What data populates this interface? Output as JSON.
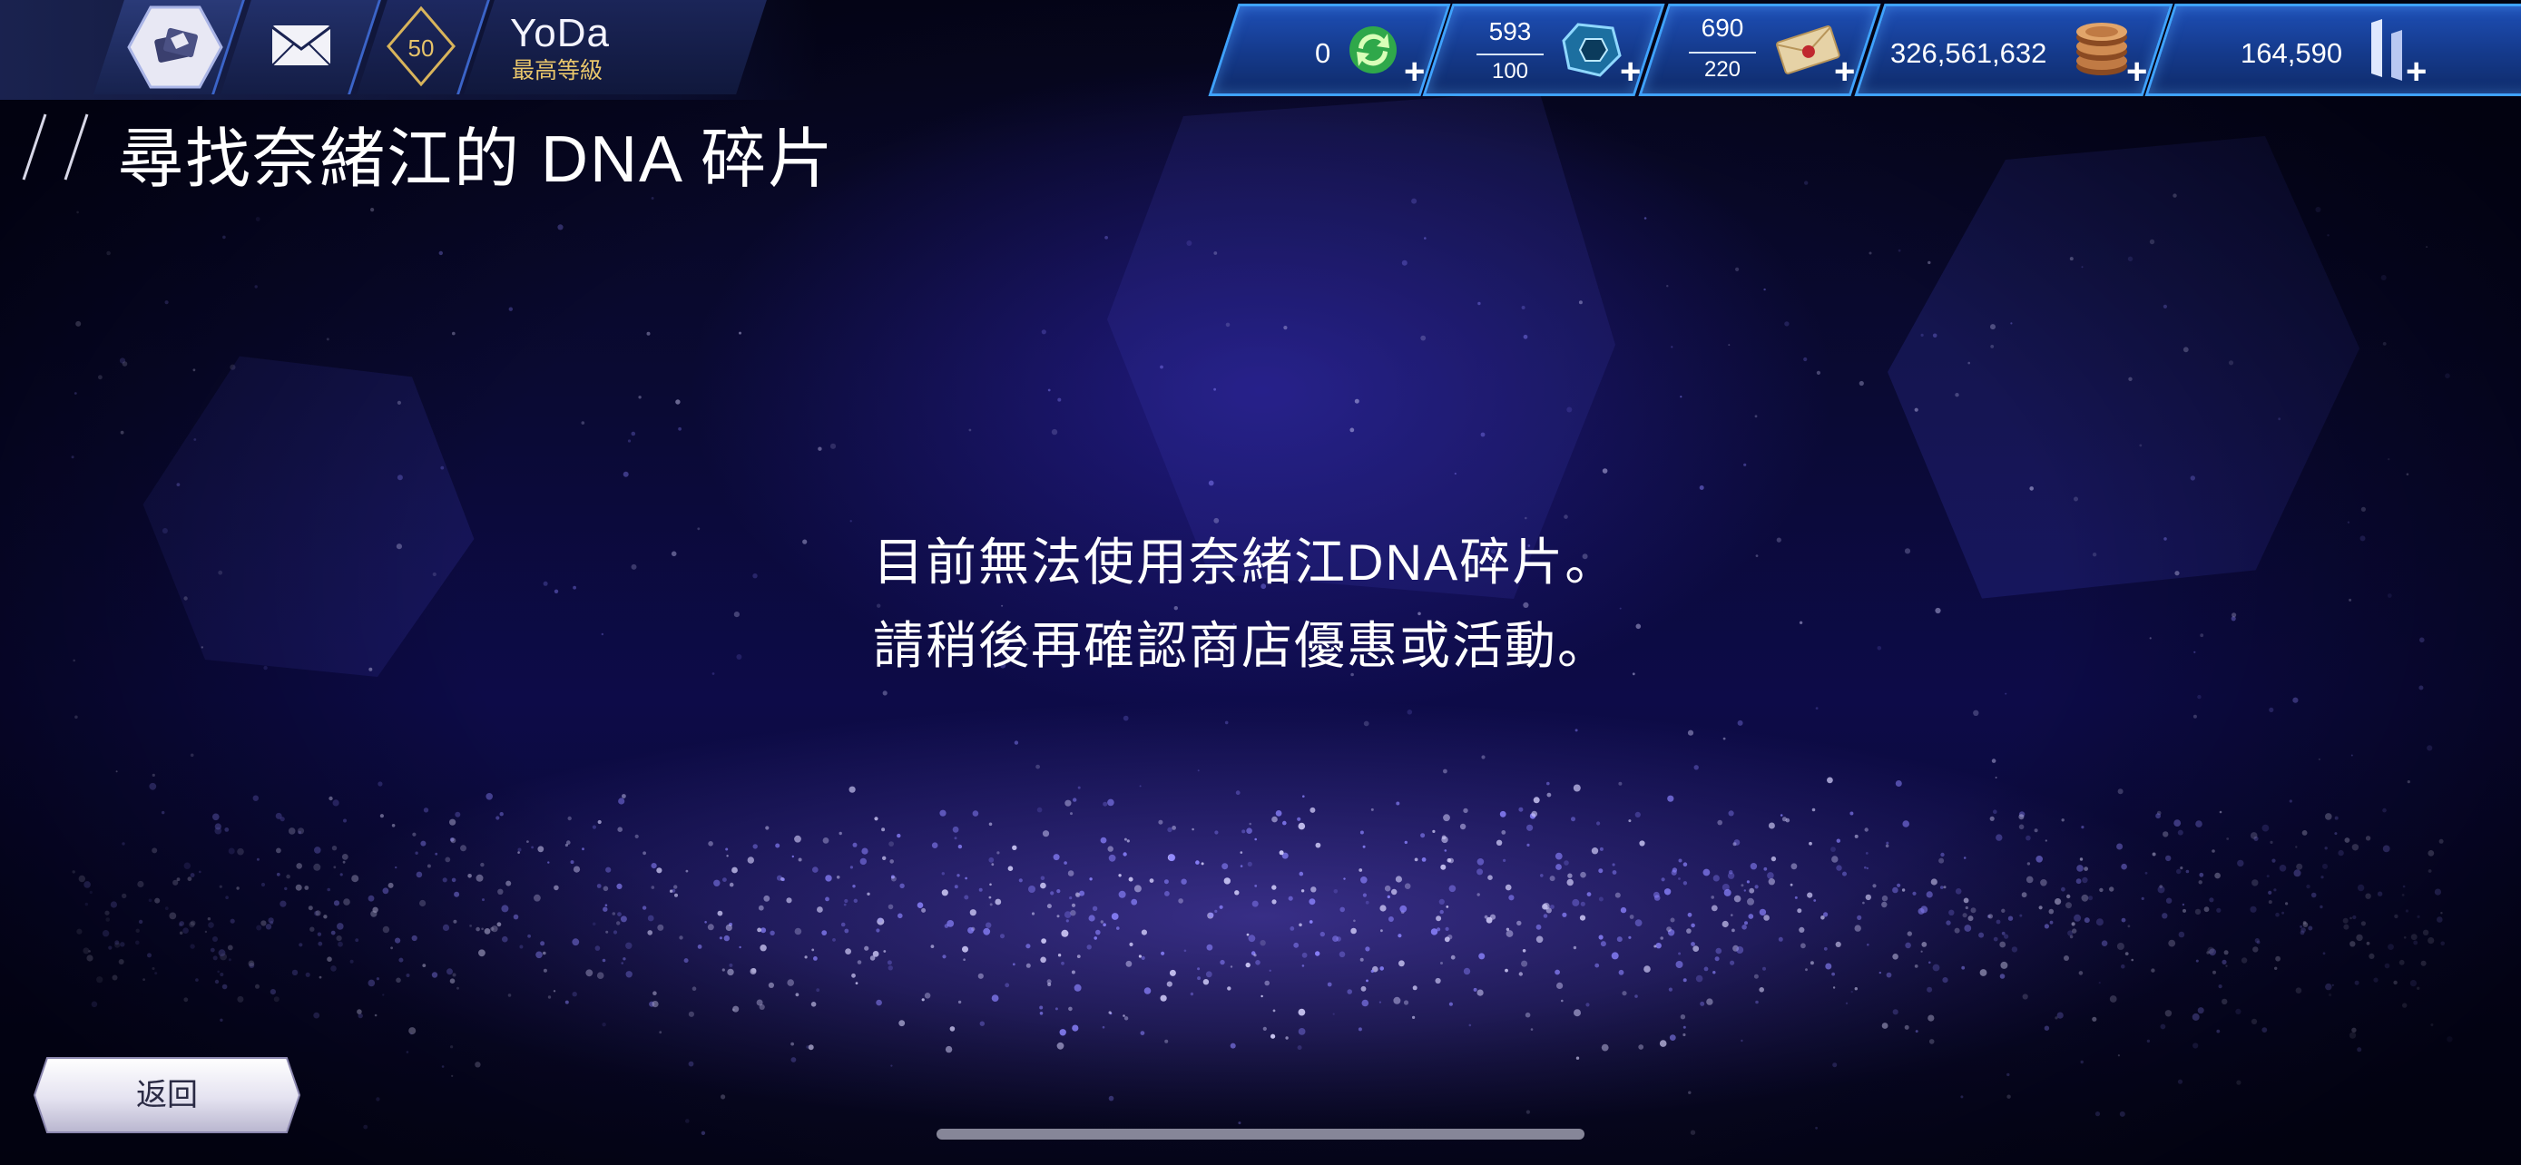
{
  "header": {
    "player_level": "50",
    "player_name": "YoDa",
    "player_rank": "最高等級"
  },
  "currencies": {
    "refresh": {
      "value": "0",
      "icon": "refresh-icon"
    },
    "gems": {
      "current": "593",
      "max": "100",
      "icon": "gem-icon"
    },
    "tickets": {
      "current": "690",
      "max": "220",
      "icon": "ticket-icon"
    },
    "coins": {
      "value": "326,561,632",
      "icon": "coin-icon"
    },
    "crystals": {
      "value": "164,590",
      "icon": "crystal-icon"
    },
    "add_label": "+"
  },
  "page": {
    "title": "尋找奈緒江的 DNA 碎片",
    "message_line1": "目前無法使用奈緒江DNA碎片。",
    "message_line2": "請稍後再確認商店優惠或活動。"
  },
  "footer": {
    "back_label": "返回"
  },
  "colors": {
    "accent": "#3fa2ff",
    "gold": "#e9c66b",
    "background": "#0d0b48"
  }
}
